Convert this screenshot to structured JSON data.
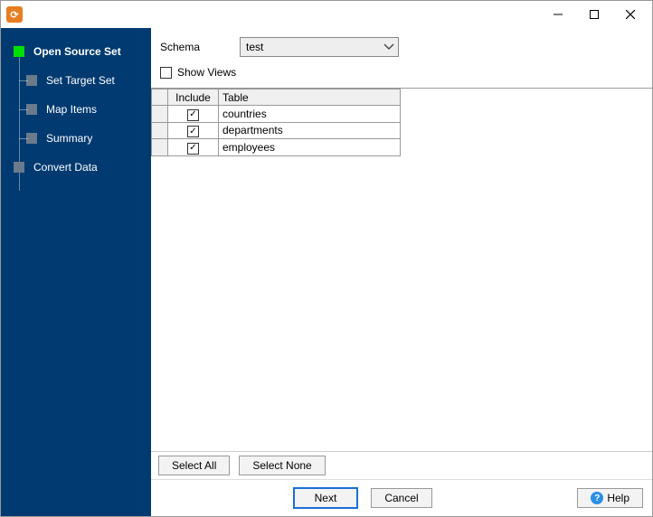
{
  "sidebar": {
    "items": [
      {
        "label": "Open Source Set",
        "active": true,
        "child": false
      },
      {
        "label": "Set Target Set",
        "active": false,
        "child": true
      },
      {
        "label": "Map Items",
        "active": false,
        "child": true
      },
      {
        "label": "Summary",
        "active": false,
        "child": true
      },
      {
        "label": "Convert Data",
        "active": false,
        "child": false
      }
    ]
  },
  "form": {
    "schema_label": "Schema",
    "schema_value": "test",
    "show_views_label": "Show Views",
    "show_views_checked": false
  },
  "grid": {
    "headers": {
      "include": "Include",
      "table": "Table"
    },
    "rows": [
      {
        "include": true,
        "table": "countries"
      },
      {
        "include": true,
        "table": "departments"
      },
      {
        "include": true,
        "table": "employees"
      }
    ]
  },
  "buttons": {
    "select_all": "Select All",
    "select_none": "Select None",
    "next": "Next",
    "cancel": "Cancel",
    "help": "Help"
  }
}
